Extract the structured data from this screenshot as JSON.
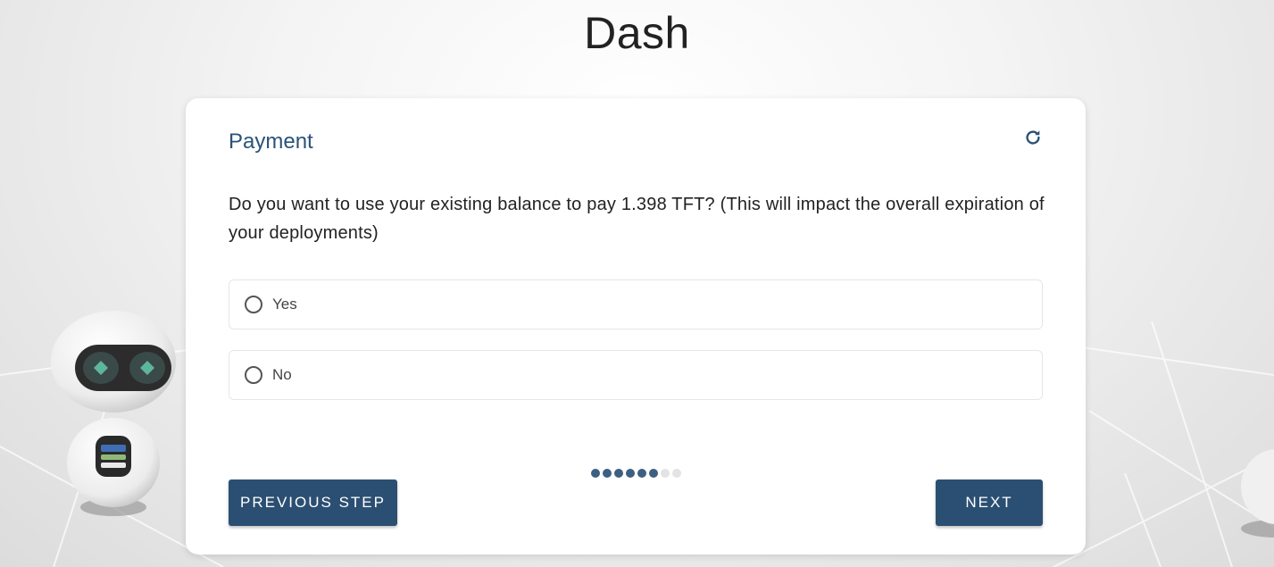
{
  "app": {
    "title": "Dash"
  },
  "form": {
    "section_title": "Payment",
    "question": "Do you want to use your existing balance to pay 1.398 TFT? (This will impact the overall expiration of your deployments)",
    "options": [
      {
        "label": "Yes",
        "selected": false
      },
      {
        "label": "No",
        "selected": false
      }
    ],
    "progress": {
      "current_step": 6,
      "total_steps": 8
    },
    "previous_label": "PREVIOUS STEP",
    "next_label": "NEXT"
  },
  "icons": {
    "refresh": "refresh-icon"
  },
  "colors": {
    "accent": "#2b5278",
    "button": "#2b4f72",
    "dot_active": "#3d5f82",
    "dot_inactive": "#e3e3e3"
  }
}
